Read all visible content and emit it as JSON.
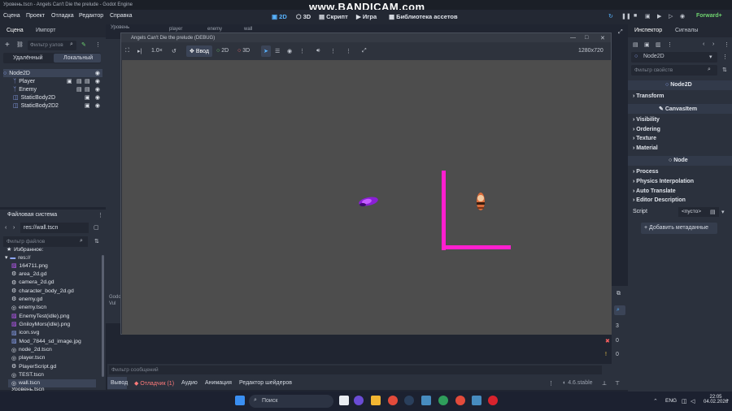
{
  "window": {
    "title": "Уровень.tscn - Angels Can't Die the prelude - Godot Engine",
    "watermark": "www.BANDICAM.com"
  },
  "menu": {
    "items": [
      "Сцена",
      "Проект",
      "Отладка",
      "Редактор",
      "Справка"
    ],
    "workspaces": [
      "2D",
      "3D",
      "Скрипт",
      "Игра",
      "Библиотека ассетов"
    ],
    "renderer": "Forward+"
  },
  "scene_dock": {
    "tabs": [
      "Сцена",
      "Импорт"
    ],
    "filter_placeholder": "Фильтр узлов",
    "modes": [
      "Удалённый",
      "Локальный"
    ],
    "tree": [
      {
        "name": "Node2D",
        "icon": "node2d-icon"
      },
      {
        "name": "Player",
        "icon": "character-icon"
      },
      {
        "name": "Enemy",
        "icon": "character-icon"
      },
      {
        "name": "StaticBody2D",
        "icon": "staticbody-icon"
      },
      {
        "name": "StaticBody2D2",
        "icon": "staticbody-icon"
      }
    ]
  },
  "filesystem": {
    "title": "Файловая система",
    "path": "res://wall.tscn",
    "filter_placeholder": "Фильтр файлов",
    "favorites": "Избранное:",
    "root": "res://",
    "files": [
      "164711.png",
      "area_2d.gd",
      "camera_2d.gd",
      "character_body_2d.gd",
      "enemy.gd",
      "enemy.tscn",
      "EnemyTest(idle).png",
      "GniloyMors(idle).png",
      "icon.svg",
      "Mod_7844_sd_image.jpg",
      "node_2d.tscn",
      "player.tscn",
      "PlayerScript.gd",
      "TEST.tscn",
      "wall.tscn"
    ],
    "cut_off_item": "Уровень.tscn"
  },
  "game_window": {
    "title": "Angels Can't Die the prelude (DEBUG)",
    "zoom": "1.0×",
    "input_label": "Ввод",
    "mode_2d": "2D",
    "mode_3d": "3D",
    "resolution": "1280x720",
    "bg_color": "#4d4d4d",
    "wall_color": "#ff1fcf"
  },
  "editor_tabs": [
    "Уровень",
    "player",
    "enemy",
    "wall"
  ],
  "inspector": {
    "tabs": [
      "Инспектор",
      "Сигналы"
    ],
    "node_name": "Node2D",
    "filter_placeholder": "Фильтр свойств",
    "class_header": "Node2D",
    "sections": [
      "Transform"
    ],
    "canvas_header": "CanvasItem",
    "canvas_sections": [
      "Visibility",
      "Ordering",
      "Texture",
      "Material"
    ],
    "node_header": "Node",
    "node_sections": [
      "Process",
      "Physics Interpolation",
      "Auto Translate",
      "Editor Description"
    ],
    "script_label": "Script",
    "script_value": "<пусто>",
    "add_metadata": "Добавить метаданные"
  },
  "bottom": {
    "filter_placeholder": "Фильтр сообщений",
    "tabs": [
      "Вывод",
      "Отладчик (1)",
      "Аудио",
      "Анимация",
      "Редактор шейдеров"
    ],
    "version": "4.6.stable",
    "counts": [
      "3",
      "0",
      "0",
      "0"
    ],
    "output_text": [
      "Godo",
      "Vul"
    ]
  },
  "taskbar": {
    "search_placeholder": "Поиск",
    "lang": "ENG",
    "time": "22:05",
    "date": "04.02.2026"
  }
}
